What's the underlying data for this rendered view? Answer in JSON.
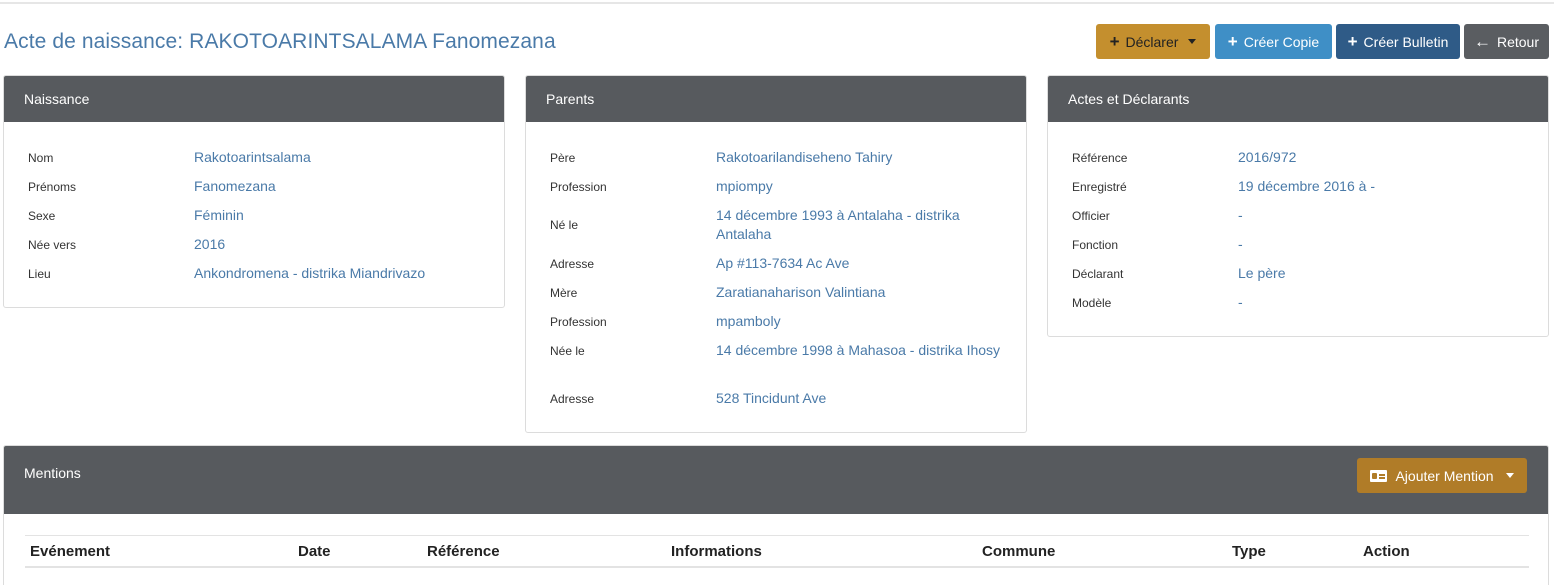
{
  "page": {
    "title": "Acte de naissance: RAKOTOARINTSALAMA Fanomezana"
  },
  "toolbar": {
    "declarer": "Déclarer",
    "creer_copie": "Créer Copie",
    "creer_bulletin": "Créer Bulletin",
    "retour": "Retour"
  },
  "naissance": {
    "title": "Naissance",
    "rows": [
      {
        "label": "Nom",
        "value": "Rakotoarintsalama"
      },
      {
        "label": "Prénoms",
        "value": "Fanomezana"
      },
      {
        "label": "Sexe",
        "value": "Féminin"
      },
      {
        "label": "Née vers",
        "value": "2016"
      },
      {
        "label": "Lieu",
        "value": "Ankondromena - distrika Miandrivazo"
      }
    ]
  },
  "parents": {
    "title": "Parents",
    "rows": [
      {
        "label": "Père",
        "value": "Rakotoarilandiseheno Tahiry"
      },
      {
        "label": "Profession",
        "value": "mpiompy"
      },
      {
        "label": "Né le",
        "value": "14 décembre 1993 à Antalaha - distrika Antalaha"
      },
      {
        "label": "Adresse",
        "value": "Ap #113-7634 Ac Ave"
      },
      {
        "label": "Mère",
        "value": "Zaratianaharison Valintiana"
      },
      {
        "label": "Profession",
        "value": "mpamboly"
      },
      {
        "label": "Née le",
        "value": "14 décembre 1998 à Mahasoa - distrika Ihosy"
      },
      {
        "label": "Adresse",
        "value": "528 Tincidunt Ave"
      }
    ]
  },
  "actes": {
    "title": "Actes et Déclarants",
    "rows": [
      {
        "label": "Référence",
        "value": "2016/972"
      },
      {
        "label": "Enregistré",
        "value": "19 décembre 2016 à -"
      },
      {
        "label": "Officier",
        "value": "-"
      },
      {
        "label": "Fonction",
        "value": "-"
      },
      {
        "label": "Déclarant",
        "value": "Le père"
      },
      {
        "label": "Modèle",
        "value": "-"
      }
    ]
  },
  "mentions": {
    "title": "Mentions",
    "add_button": "Ajouter Mention",
    "columns": [
      "Evénement",
      "Date",
      "Référence",
      "Informations",
      "Commune",
      "Type",
      "Action"
    ]
  },
  "colors": {
    "link": "#4a7aa8",
    "header_bg": "#575a5e",
    "declarer": "#c48f2e",
    "copie": "#3f8fc6",
    "bulletin": "#2f5b87",
    "retour": "#5a5d61",
    "mention_btn": "#b07c28"
  }
}
